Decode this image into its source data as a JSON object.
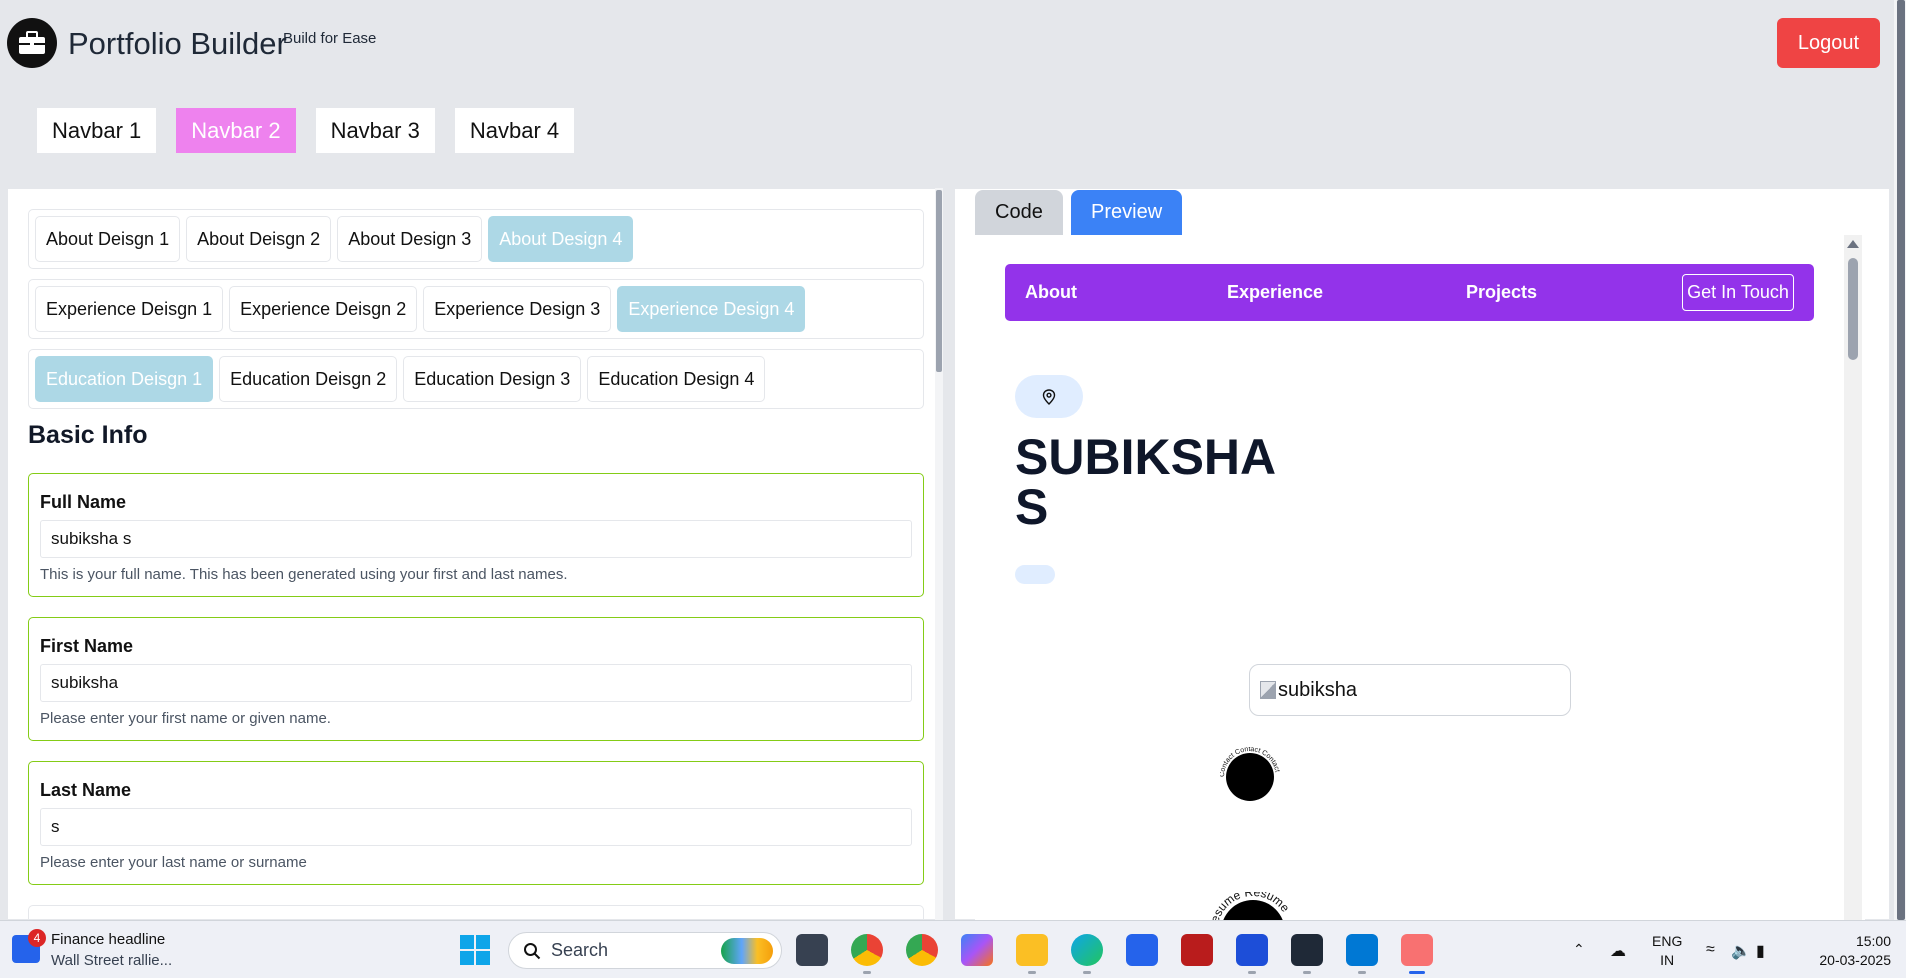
{
  "header": {
    "title": "Portfolio Builder",
    "tagline": "Build for Ease",
    "logout_label": "Logout",
    "navbar_options": [
      "Navbar 1",
      "Navbar 2",
      "Navbar 3",
      "Navbar 4"
    ],
    "active_navbar": "Navbar 2"
  },
  "designs": {
    "about": [
      "About Deisgn 1",
      "About Deisgn 2",
      "About Design 3",
      "About Design 4"
    ],
    "about_active": "About Design 4",
    "experience": [
      "Experience Deisgn 1",
      "Experience Deisgn 2",
      "Experience Design 3",
      "Experience Design 4"
    ],
    "experience_active": "Experience Design 4",
    "education": [
      "Education Deisgn 1",
      "Education Deisgn 2",
      "Education Design 3",
      "Education Design 4"
    ],
    "education_active": "Education Deisgn 1"
  },
  "basic_info": {
    "title": "Basic Info",
    "fields": [
      {
        "label": "Full Name",
        "value": "subiksha s",
        "help": "This is your full name. This has been generated using your first and last names."
      },
      {
        "label": "First Name",
        "value": "subiksha",
        "help": "Please enter your first name or given name."
      },
      {
        "label": "Last Name",
        "value": "s",
        "help": "Please enter your last name or surname"
      }
    ]
  },
  "tabs": {
    "code": "Code",
    "preview": "Preview",
    "active": "Preview"
  },
  "preview": {
    "nav_links": [
      "About",
      "Experience",
      "Projects"
    ],
    "cta": "Get In Touch",
    "name_line1": "SUBIKSHA",
    "name_line2": "S",
    "image_alt": "subiksha",
    "contact_ring_text": "Contact Contact Contact",
    "resume_ring_text": "Resume Resume"
  },
  "taskbar": {
    "news_badge": "4",
    "news_title": "Finance headline",
    "news_subtitle": "Wall Street rallie...",
    "search_placeholder": "Search",
    "lang_line1": "ENG",
    "lang_line2": "IN",
    "time": "15:00",
    "date": "20-03-2025"
  },
  "colors": {
    "accent_pink": "#ee82ee",
    "design_active": "#add8e6",
    "logout": "#ef4444",
    "preview_tab": "#3b82f6",
    "preview_nav": "#9333ea",
    "field_border": "#84cc16"
  }
}
